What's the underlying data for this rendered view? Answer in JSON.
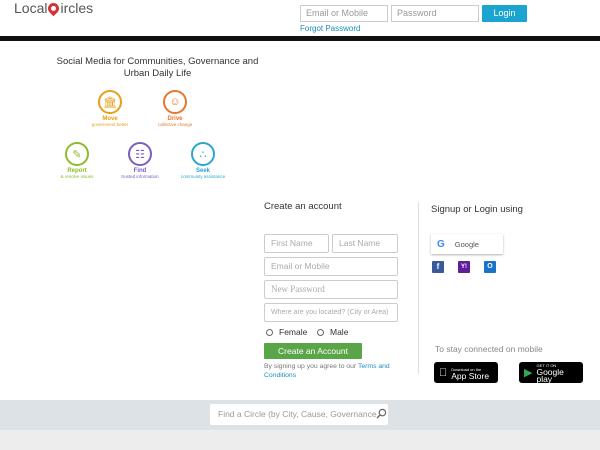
{
  "header": {
    "logo_left": "Local",
    "logo_right": "ircles",
    "email_placeholder": "Email or Mobile",
    "password_placeholder": "Password",
    "login_label": "Login",
    "forgot_label": "Forgot Password"
  },
  "tagline": "Social Media for Communities, Governance and Urban Daily Life",
  "features": [
    {
      "label": "Move",
      "sub": "government better",
      "icon": "government-building-icon",
      "color": "#e6a019"
    },
    {
      "label": "Drive",
      "sub": "collective change",
      "icon": "people-group-icon",
      "color": "#e8772c"
    },
    {
      "label": "Report",
      "sub": "& resolve issues",
      "icon": "report-document-icon",
      "color": "#8dbb2b"
    },
    {
      "label": "Find",
      "sub": "trusted information",
      "icon": "search-info-icon",
      "color": "#7a5ec2"
    },
    {
      "label": "Seek",
      "sub": "community assistance",
      "icon": "community-network-icon",
      "color": "#2aa6cf"
    }
  ],
  "create_account": {
    "title": "Create an account",
    "first_name": "First Name",
    "last_name": "Last Name",
    "email_mobile": "Email or Mobile",
    "new_password": "New Password",
    "location": "Where are you located? (City or Area)",
    "female": "Female",
    "male": "Male",
    "button": "Create an Account",
    "terms_prefix": "By signing up you agree to our",
    "terms_link": "Terms and Conditions"
  },
  "signup": {
    "title": "Signup or Login using",
    "google_label": "Google",
    "google_glyph": "G",
    "fb_glyph": "f",
    "yahoo_glyph": "Y!",
    "ms_glyph": "O"
  },
  "mobile": {
    "text": "To stay connected on mobile",
    "appstore_small": "Download on the",
    "appstore_big": "App Store",
    "gplay_small": "GET IT ON",
    "gplay_big": "Google play"
  },
  "footer": {
    "find_placeholder": "Find a Circle (by City, Cause, Governance"
  },
  "colors": {
    "accent_blue": "#1aa4cf",
    "create_green": "#5aa548",
    "logo_red": "#d3343a"
  }
}
